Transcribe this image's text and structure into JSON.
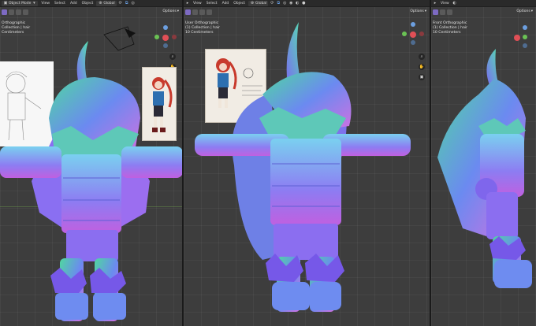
{
  "left_viewport": {
    "mode_label": "Object Mode",
    "menu": [
      "View",
      "Select",
      "Add",
      "Object"
    ],
    "orientation": "Global",
    "options_label": "Options",
    "overlay_lines": [
      "Orthographic",
      "Collection | hair",
      "Centimeters"
    ]
  },
  "middle_viewport": {
    "menu": [
      "View",
      "Select",
      "Add",
      "Object"
    ],
    "orientation": "Global",
    "options_label": "Options",
    "overlay_lines": [
      "User Orthographic",
      "(1) Collection | hair",
      "10 Centimeters"
    ]
  },
  "right_viewport": {
    "menu": [
      "View"
    ],
    "options_label": "Options",
    "overlay_lines": [
      "Front Orthographic",
      "(1) Collection | hair",
      "10 Centimeters"
    ]
  },
  "gizmo_labels": {
    "x": "X",
    "y": "Y",
    "z": "Z"
  },
  "colors": {
    "header": "#2a2a2a",
    "viewport_bg": "#3d3d3d",
    "active_tool": "#7d6ac2",
    "accent": "#6ba3e8"
  }
}
